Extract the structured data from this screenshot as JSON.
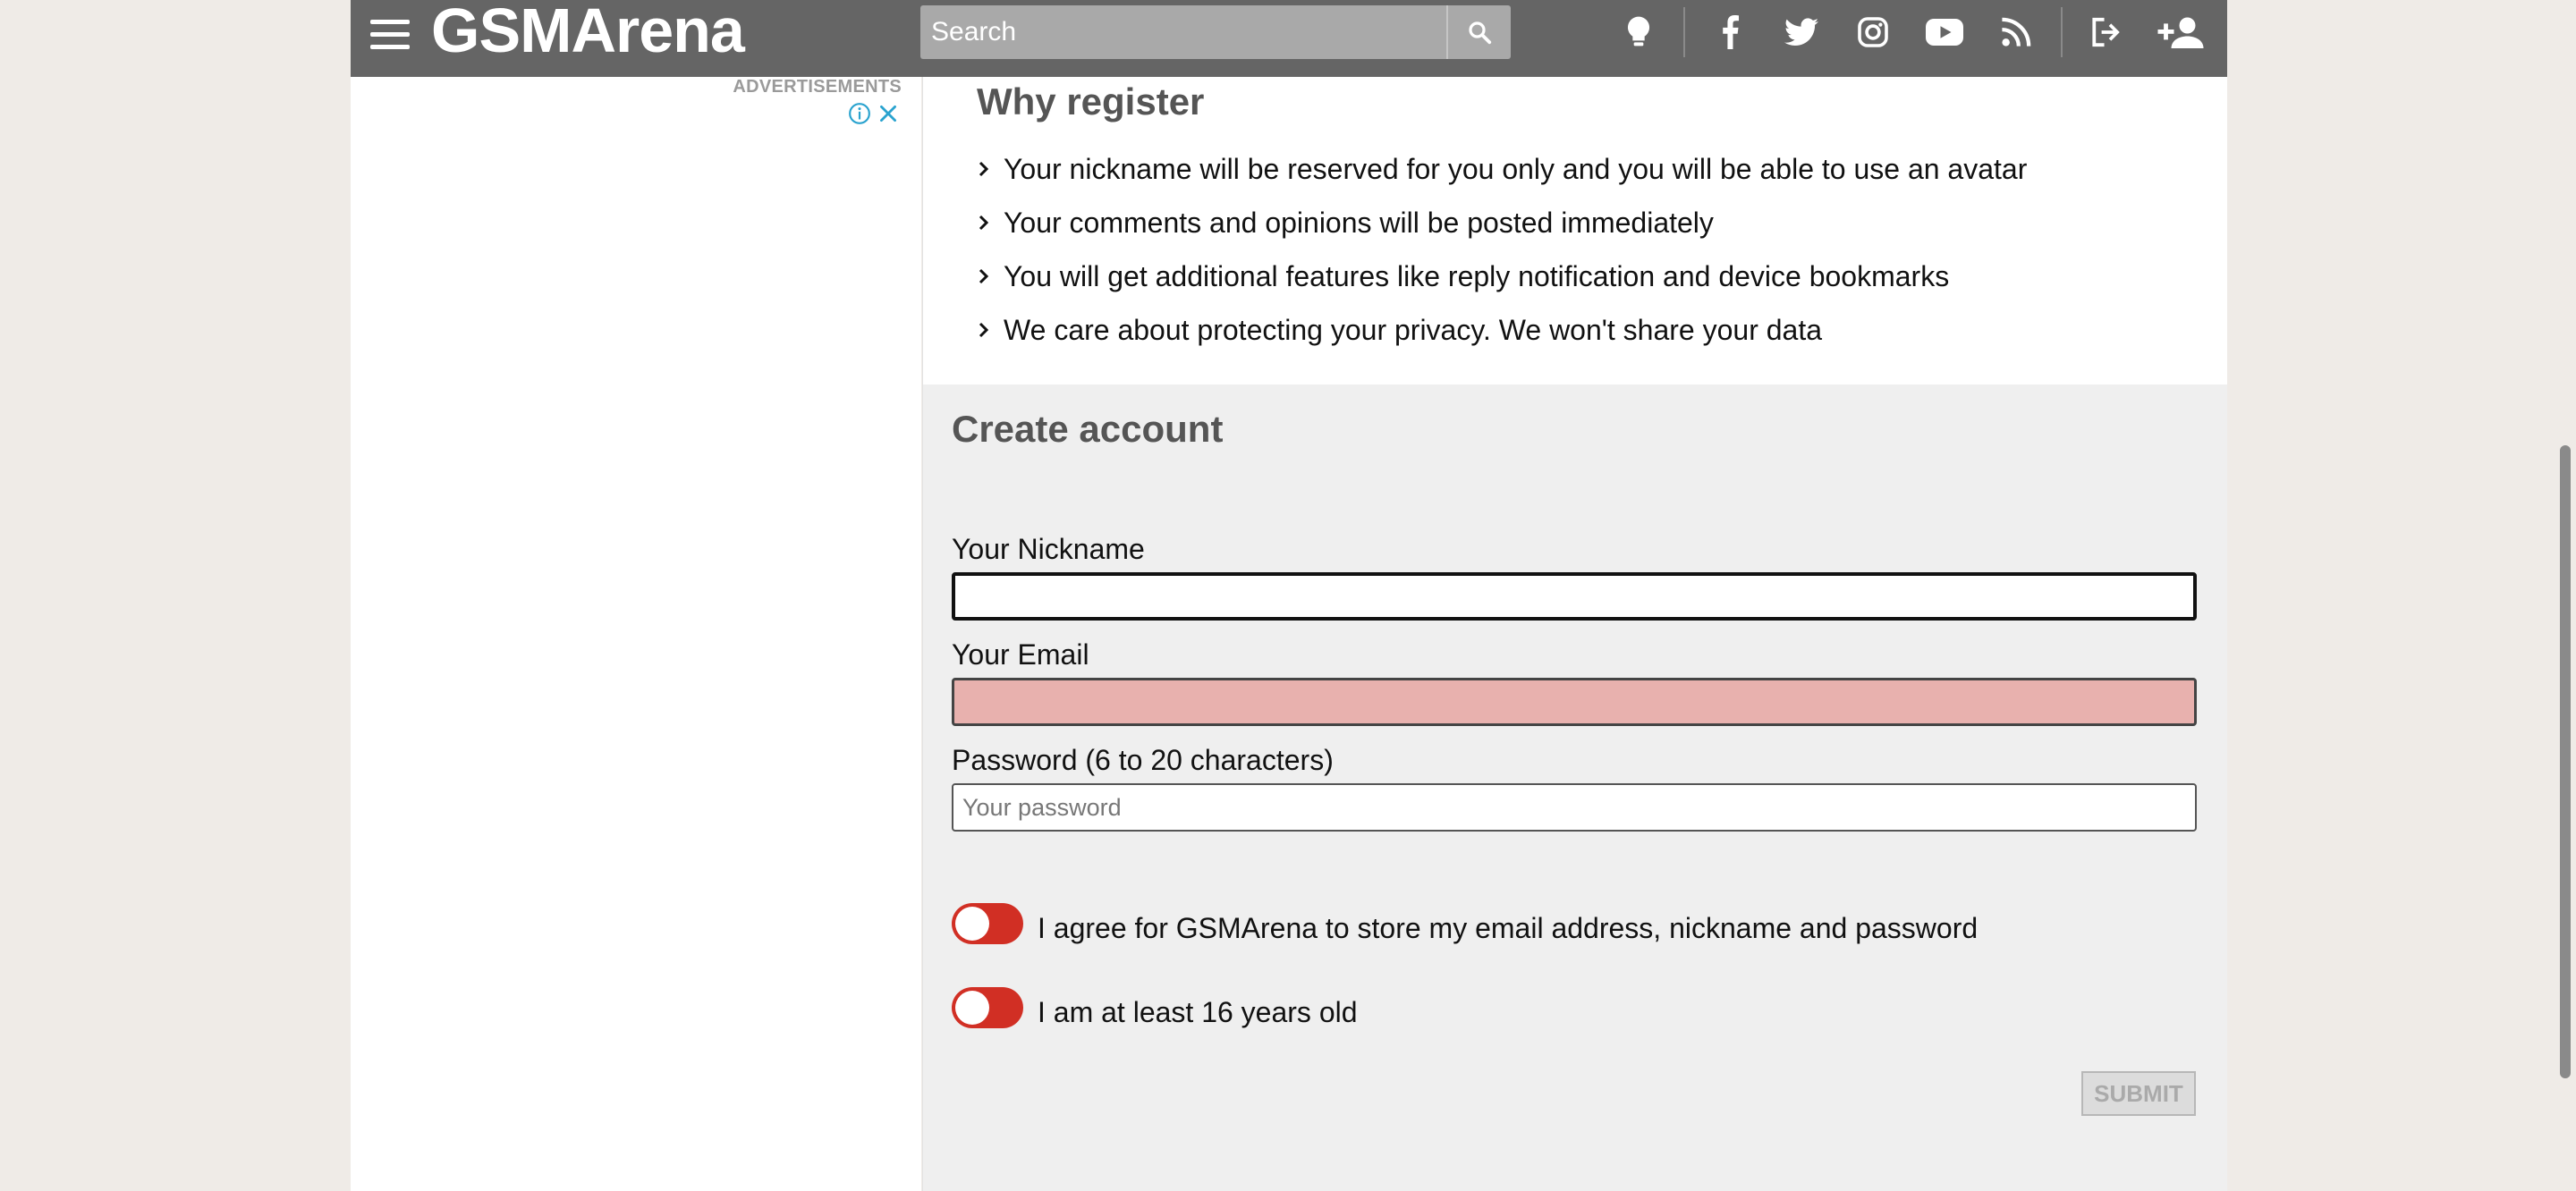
{
  "header": {
    "logo_text": "GSMArena",
    "search_placeholder": "Search",
    "icons": [
      "menu-icon",
      "search-icon",
      "bulb-icon",
      "facebook-icon",
      "twitter-icon",
      "instagram-icon",
      "youtube-icon",
      "rss-icon",
      "login-icon",
      "add-user-icon"
    ]
  },
  "ads": {
    "label": "ADVERTISEMENTS"
  },
  "why_register": {
    "title": "Why register",
    "items": [
      "Your nickname will be reserved for you only and you will be able to use an avatar",
      "Your comments and opinions will be posted immediately",
      "You will get additional features like reply notification and device bookmarks",
      "We care about protecting your privacy. We won't share your data"
    ]
  },
  "form": {
    "title": "Create account",
    "nickname_label": "Your Nickname",
    "nickname_value": "",
    "email_label": "Your Email",
    "email_value": "",
    "password_label": "Password (6 to 20 characters)",
    "password_placeholder": "Your password",
    "agree_label": "I agree for GSMArena to store my email address, nickname and password",
    "age_label": "I am at least 16 years old",
    "submit_label": "SUBMIT"
  },
  "colors": {
    "header_bg": "#656565",
    "toggle_off": "#d12f24",
    "email_error_bg": "#e8b1ae"
  }
}
